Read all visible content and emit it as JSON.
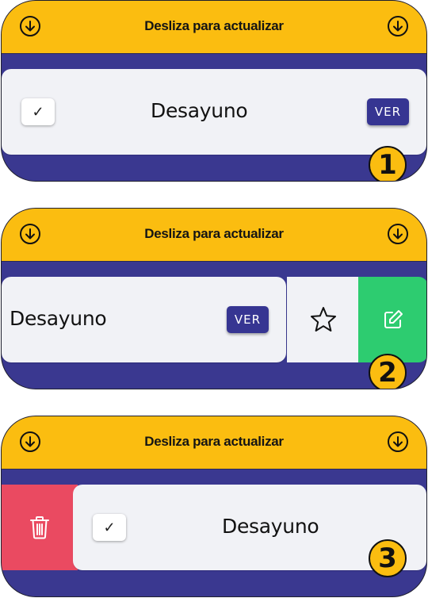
{
  "header": {
    "title": "Desliza para actualizar"
  },
  "item": {
    "label": "Desayuno",
    "view_button": "VER"
  },
  "checkbox": {
    "mark": "✓"
  },
  "badges": [
    "1",
    "2",
    "3"
  ],
  "icons": {
    "refresh": "arrow-down-circle-icon",
    "favorite": "star-icon",
    "edit": "edit-icon",
    "delete": "trash-icon"
  },
  "colors": {
    "header": "#fbbd10",
    "panel": "#3a3890",
    "card": "#f1f2f6",
    "button": "#363592",
    "edit": "#2dcc70",
    "delete": "#ea4a61"
  }
}
